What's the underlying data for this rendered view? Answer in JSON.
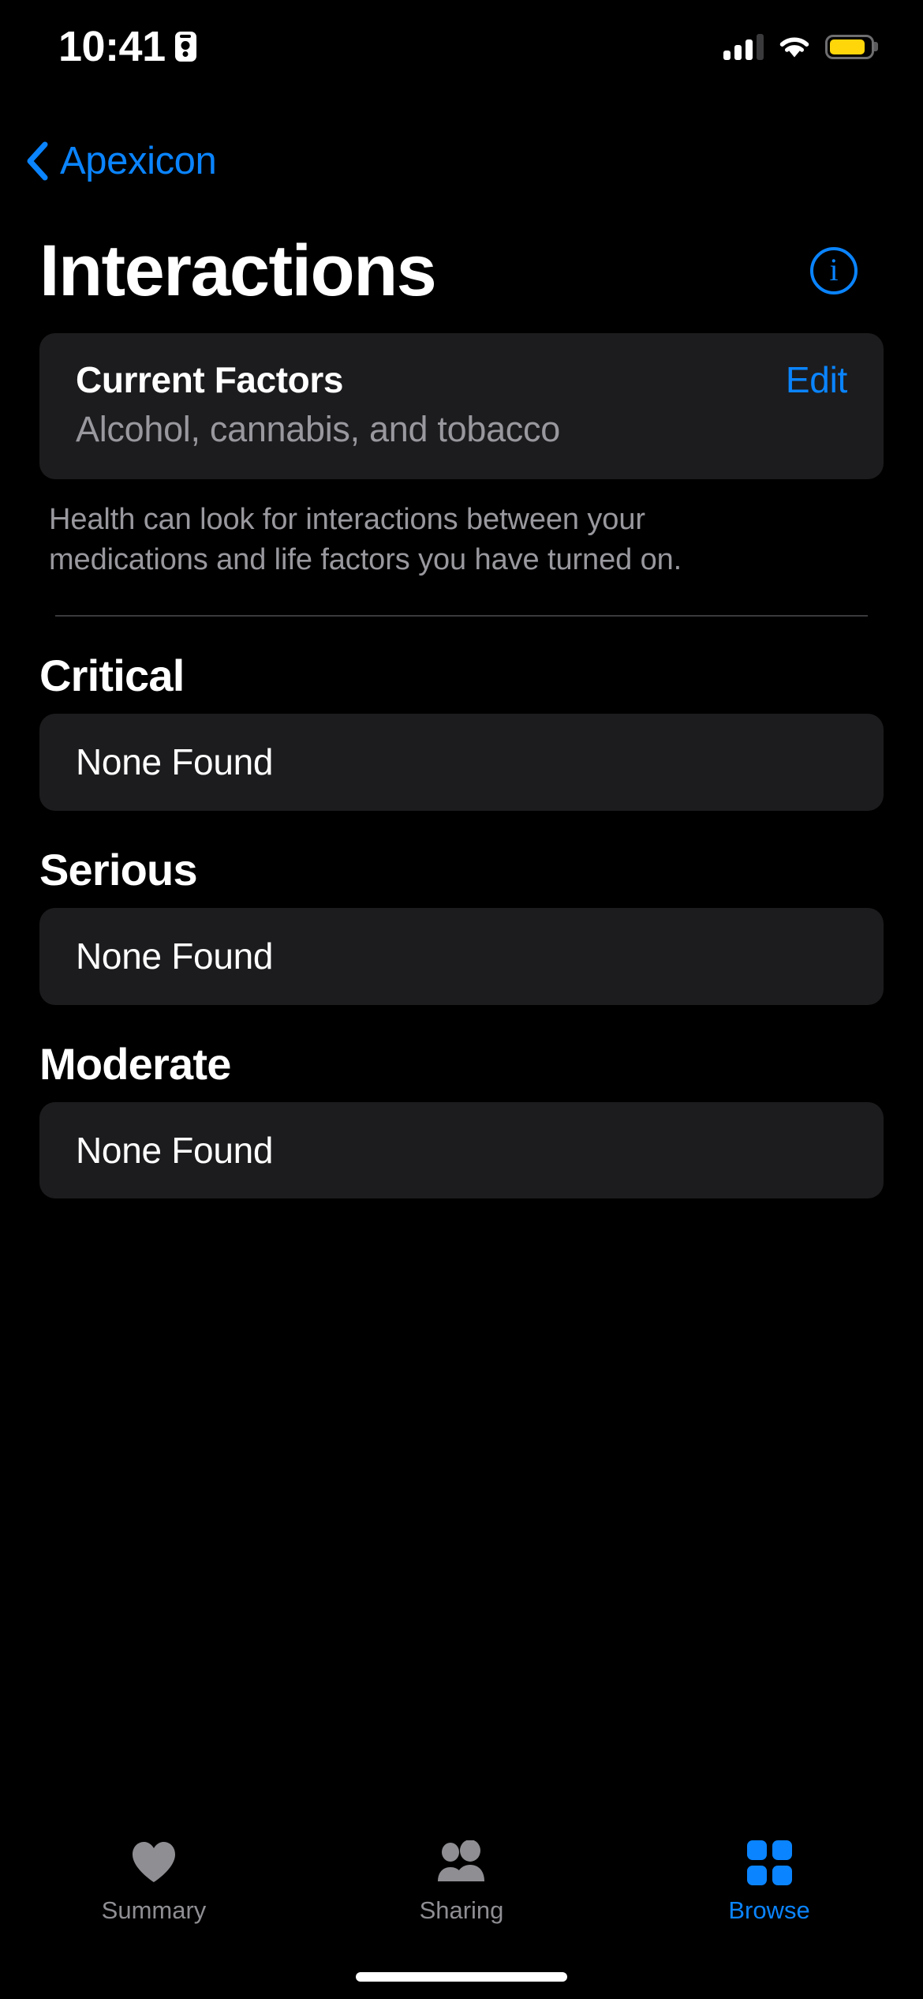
{
  "status_bar": {
    "time": "10:41",
    "record_icon": "contact-card-icon",
    "cellular_icon": "cellular-bars-icon",
    "cellular_bars_filled": 3,
    "cellular_bars_total": 4,
    "wifi_icon": "wifi-icon",
    "battery_icon": "battery-icon",
    "battery_level_percent": 85,
    "battery_color": "#FFD60A"
  },
  "nav": {
    "back_label": "Apexicon",
    "back_icon": "chevron-left-icon",
    "accent_color": "#0A84FF"
  },
  "header": {
    "title": "Interactions",
    "info_icon": "info-circle-icon",
    "info_glyph": "i"
  },
  "current_factors": {
    "title": "Current Factors",
    "subtitle": "Alcohol, cannabis, and tobacco",
    "edit_label": "Edit"
  },
  "footer_note": "Health can look for interactions between your medications and life factors you have turned on.",
  "sections": [
    {
      "header": "Critical",
      "row_label": "None Found"
    },
    {
      "header": "Serious",
      "row_label": "None Found"
    },
    {
      "header": "Moderate",
      "row_label": "None Found"
    }
  ],
  "tab_bar": {
    "tabs": [
      {
        "label": "Summary",
        "icon": "heart-icon",
        "active": false
      },
      {
        "label": "Sharing",
        "icon": "two-people-icon",
        "active": false
      },
      {
        "label": "Browse",
        "icon": "grid-squares-icon",
        "active": true
      }
    ],
    "active_color": "#0A84FF",
    "inactive_color": "#8E8E93"
  },
  "colors": {
    "background": "#000000",
    "card": "#1C1C1E",
    "secondary_text": "#98989E",
    "accent": "#0A84FF"
  }
}
